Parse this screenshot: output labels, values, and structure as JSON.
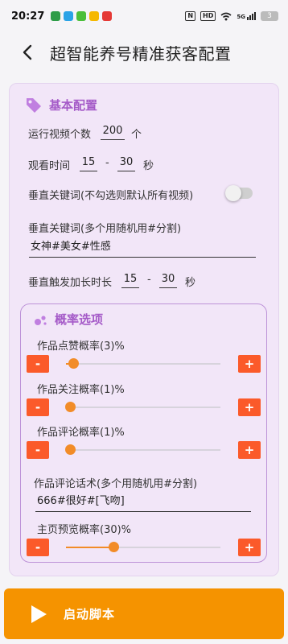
{
  "status_bar": {
    "time": "20:27",
    "nfc": "N",
    "hd": "HD",
    "signal": "5G",
    "battery": "3"
  },
  "header": {
    "title": "超智能养号精准获客配置"
  },
  "basic": {
    "title": "基本配置",
    "video_count_label": "运行视频个数",
    "video_count_value": "200",
    "video_count_unit": "个",
    "watch_time_label": "观看时间",
    "watch_time_min": "15",
    "watch_time_sep": "-",
    "watch_time_max": "30",
    "watch_time_unit": "秒",
    "vertical_toggle_label": "垂直关键词(不勾选则默认所有视频)",
    "vertical_toggle_on": false,
    "keywords_label": "垂直关键词(多个用随机用#分割)",
    "keywords_value": "女神#美女#性感",
    "trigger_label": "垂直触发加长时长",
    "trigger_min": "15",
    "trigger_sep": "-",
    "trigger_max": "30",
    "trigger_unit": "秒"
  },
  "probability": {
    "title": "概率选项",
    "like_label": "作品点赞概率(3)%",
    "like_value": 3,
    "follow_label": "作品关注概率(1)%",
    "follow_value": 1,
    "comment_label": "作品评论概率(1)%",
    "comment_value": 1,
    "comment_words_label": "作品评论话术(多个用随机用#分割)",
    "comment_words_value": "666#很好#[飞吻]",
    "home_preview_label": "主页预览概率(30)%",
    "home_preview_value": 30,
    "minus": "-",
    "plus": "+"
  },
  "start_button": {
    "label": "启动脚本"
  },
  "colors": {
    "accent": "#a55bc8",
    "button_orange": "#fb5a2a",
    "slider_orange": "#f28c28",
    "start_orange": "#f59300",
    "card_bg": "#f2e6f8"
  }
}
